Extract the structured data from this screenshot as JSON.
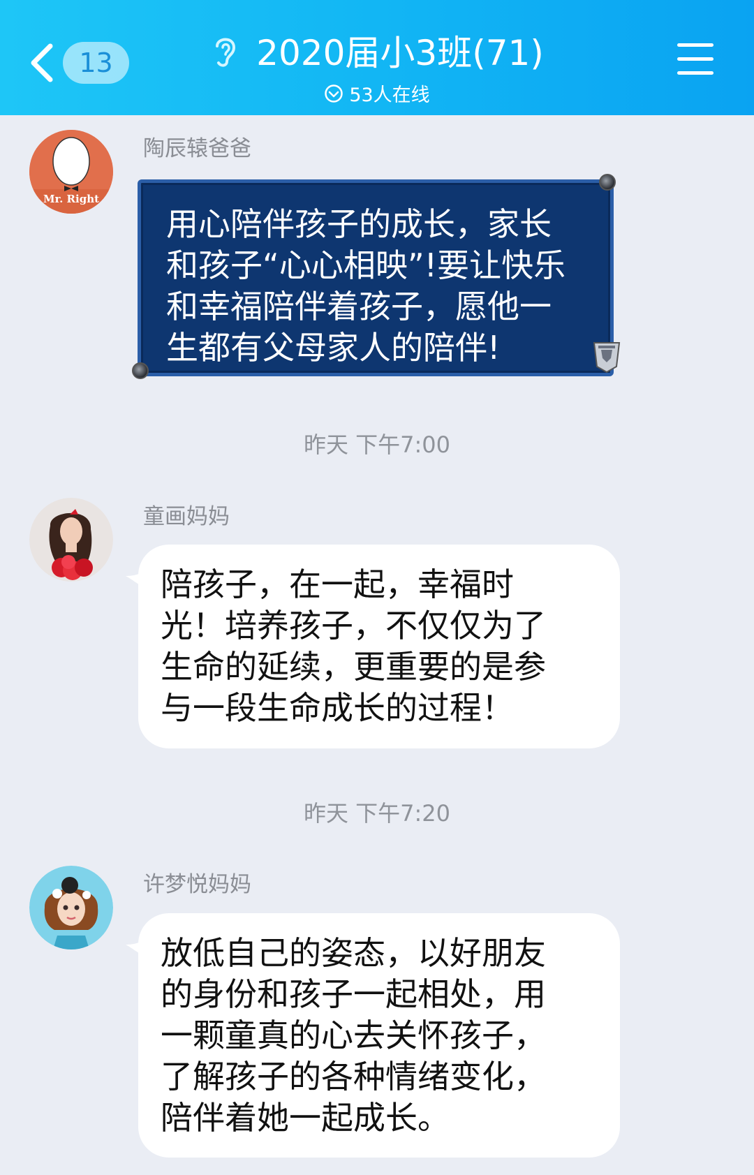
{
  "header": {
    "back_count": "13",
    "title": "2020届小3班(71)",
    "online": "53人在线"
  },
  "messages": [
    {
      "sender": "陶辰辕爸爸",
      "avatar_text": "Mr. Right",
      "lines": [
        "用心陪伴孩子的成长，家长",
        "和孩子“心心相映”!要让快乐",
        "和幸福陪伴着孩子，愿他一",
        "生都有父母家人的陪伴!"
      ]
    },
    {
      "timestamp": "昨天 下午7:00",
      "sender": "童画妈妈",
      "lines": [
        "陪孩子，在一起，幸福时",
        "光！培养孩子，不仅仅为了",
        "生命的延续，更重要的是参",
        "与一段生命成长的过程！"
      ]
    },
    {
      "timestamp": "昨天 下午7:20",
      "sender": "许梦悦妈妈",
      "lines": [
        "放低自己的姿态，以好朋友",
        "的身份和孩子一起相处，用",
        "一颗童真的心去关怀孩子，",
        "了解孩子的各种情绪变化，",
        "陪伴着她一起成长。"
      ]
    }
  ],
  "colors": {
    "header_start": "#1ec6f7",
    "header_end": "#0aa3f2",
    "background": "#eaedf4",
    "special_bubble": "#0e3670"
  }
}
